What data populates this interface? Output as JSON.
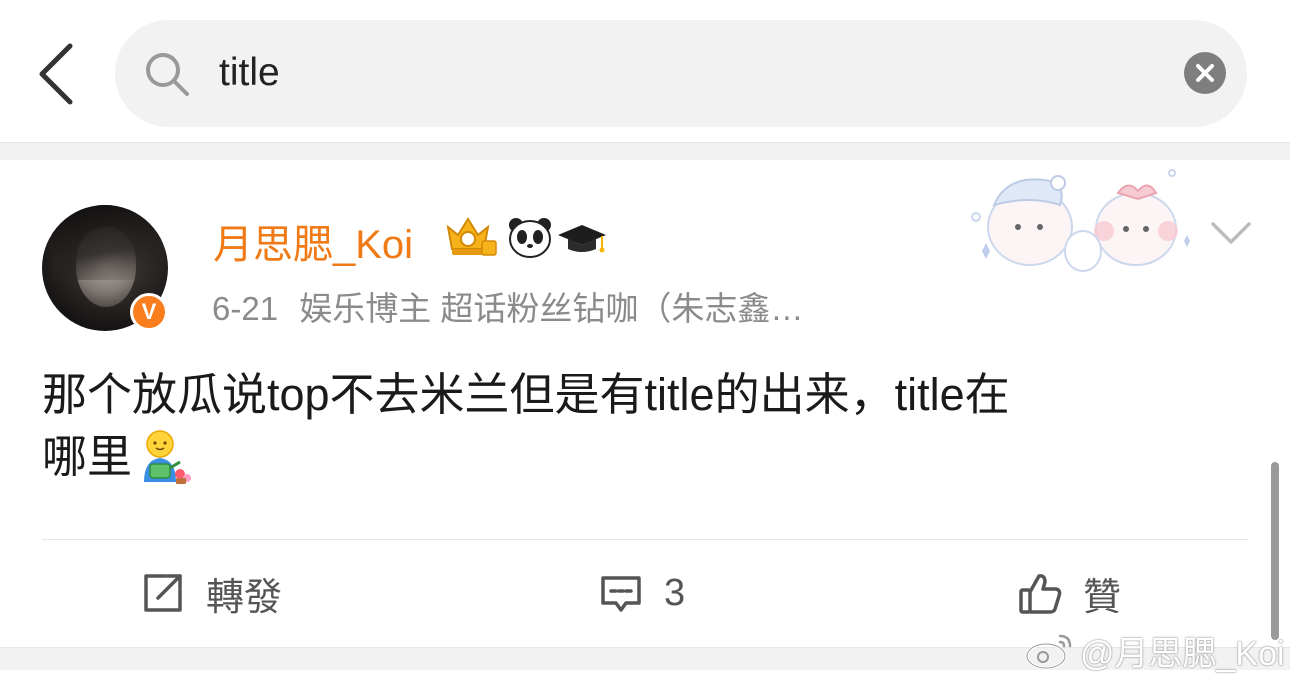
{
  "search": {
    "query": "title",
    "placeholder": "",
    "icons": {
      "back": "chevron-left-icon",
      "search": "search-icon",
      "clear": "clear-icon"
    }
  },
  "post": {
    "username": "月思腮_Koi",
    "badges": [
      "crown-badge-icon",
      "panda-icon",
      "graduation-cap-icon"
    ],
    "verified_mark": "V",
    "date": "6-21",
    "profile_desc": "娱乐博主 超话粉丝钻咖（朱志鑫…",
    "content_line1": "那个放瓜说top不去米兰但是有title的出来，title在",
    "content_line2": "哪里",
    "content_emoji": "watering-can-emoji-icon"
  },
  "actions": {
    "repost_label": "轉發",
    "comment_count": "3",
    "like_label": "贊"
  },
  "watermark": "@月思腮_Koi",
  "colors": {
    "accent": "#f07a16",
    "verified": "#fa7d1e",
    "meta_text": "#8b8b8b",
    "separator": "#f2f2f2"
  }
}
